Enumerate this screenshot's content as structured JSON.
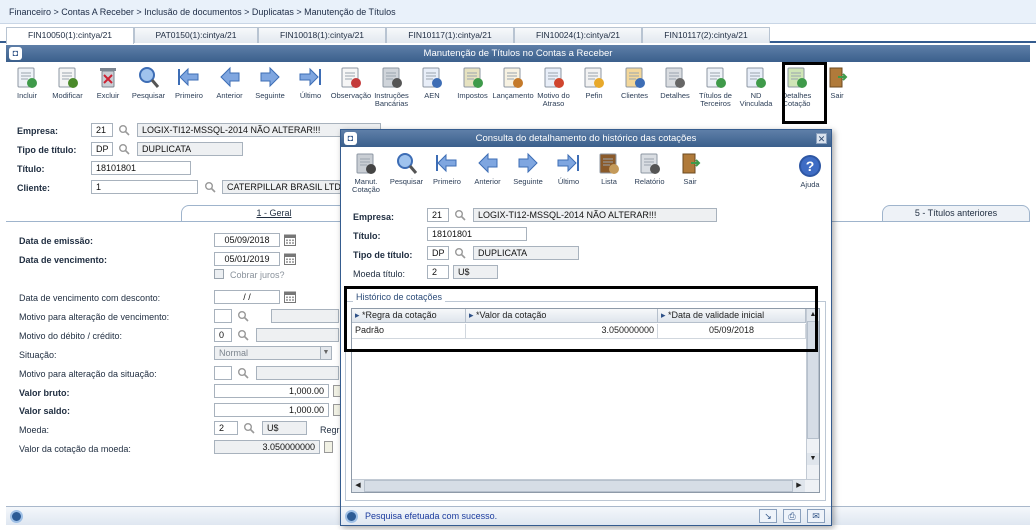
{
  "breadcrumb": "Financeiro > Contas A Receber > Inclusão de documentos > Duplicatas > Manutenção de Títulos",
  "tabs": [
    "FIN10050(1):cintya/21",
    "PAT0150(1):cintya/21",
    "FIN10018(1):cintya/21",
    "FIN10117(1):cintya/21",
    "FIN10024(1):cintya/21",
    "FIN10117(2):cintya/21"
  ],
  "main_window": {
    "title": "Manutenção de Títulos no Contas a Receber",
    "toolbar": [
      {
        "label": "Incluir",
        "icon": "add-document-icon"
      },
      {
        "label": "Modificar",
        "icon": "edit-check-icon"
      },
      {
        "label": "Excluir",
        "icon": "trash-icon"
      },
      {
        "label": "Pesquisar",
        "icon": "magnifier-icon"
      },
      {
        "label": "Primeiro",
        "icon": "first-arrow-icon"
      },
      {
        "label": "Anterior",
        "icon": "previous-arrow-icon"
      },
      {
        "label": "Seguinte",
        "icon": "next-arrow-icon"
      },
      {
        "label": "Último",
        "icon": "last-arrow-icon"
      },
      {
        "label": "Observação",
        "icon": "note-pen-icon"
      },
      {
        "label": "Instruções Bancárias",
        "icon": "bank-instructions-icon"
      },
      {
        "label": "AEN",
        "icon": "aen-form-icon"
      },
      {
        "label": "Impostos",
        "icon": "taxes-icon"
      },
      {
        "label": "Lançamento",
        "icon": "posting-icon"
      },
      {
        "label": "Motivo do Atraso",
        "icon": "delay-reason-icon"
      },
      {
        "label": "Pefin",
        "icon": "pefin-icon"
      },
      {
        "label": "Clientes",
        "icon": "clients-icon"
      },
      {
        "label": "Detalhes",
        "icon": "details-tools-icon"
      },
      {
        "label": "Títulos de Terceiros",
        "icon": "third-party-titles-icon"
      },
      {
        "label": "ND Vinculada",
        "icon": "nd-linked-icon"
      },
      {
        "label": "Detalhes Cotação",
        "icon": "quote-details-icon"
      },
      {
        "label": "Sair",
        "icon": "exit-door-icon"
      }
    ],
    "form": {
      "empresa_label": "Empresa:",
      "empresa_code": "21",
      "empresa_name": "LOGIX-TI12-MSSQL-2014 NÃO ALTERAR!!!",
      "tipo_label": "Tipo de título:",
      "tipo_code": "DP",
      "tipo_name": "DUPLICATA",
      "titulo_label": "Título:",
      "titulo_value": "18101801",
      "cliente_label": "Cliente:",
      "cliente_code": "1",
      "cliente_name": "CATERPILLAR BRASIL LTDA"
    },
    "folder_tabs": {
      "geral": "1 - Geral",
      "anteriores": "5 - Títulos anteriores"
    },
    "geral": {
      "emissao_label": "Data de emissão:",
      "emissao_value": "05/09/2018",
      "vencimento_label": "Data de vencimento:",
      "vencimento_value": "05/01/2019",
      "cobrar_juros": "Cobrar juros?",
      "venc_desconto_label": "Data de vencimento com desconto:",
      "venc_desconto_value": "/ /",
      "motivo_alt_label": "Motivo para alteração de vencimento:",
      "motivo_debito_label": "Motivo do débito / crédito:",
      "motivo_debito_value": "0",
      "situacao_label": "Situação:",
      "situacao_value": "Normal",
      "motivo_sit_label": "Motivo para alteração da situação:",
      "valor_bruto_label": "Valor bruto:",
      "valor_bruto_value": "1,000.00",
      "valor_saldo_label": "Valor saldo:",
      "valor_saldo_value": "1,000.00",
      "moeda_label": "Moeda:",
      "moeda_code": "2",
      "moeda_symbol": "U$",
      "regra_label": "Regr",
      "cotacao_label": "Valor da cotação da moeda:",
      "cotacao_value": "3.050000000"
    }
  },
  "modal": {
    "title": "Consulta do detalhamento do histórico das cotações",
    "toolbar": [
      {
        "label": "Manut. Cotação",
        "icon": "quote-maintenance-icon"
      },
      {
        "label": "Pesquisar",
        "icon": "magnifier-icon"
      },
      {
        "label": "Primeiro",
        "icon": "first-arrow-icon"
      },
      {
        "label": "Anterior",
        "icon": "previous-arrow-icon"
      },
      {
        "label": "Seguinte",
        "icon": "next-arrow-icon"
      },
      {
        "label": "Último",
        "icon": "last-arrow-icon"
      },
      {
        "label": "Lista",
        "icon": "book-list-icon"
      },
      {
        "label": "Relatório",
        "icon": "printer-icon"
      },
      {
        "label": "Sair",
        "icon": "exit-door-icon"
      }
    ],
    "help_label": "Ajuda",
    "form": {
      "empresa_label": "Empresa:",
      "empresa_code": "21",
      "empresa_name": "LOGIX-TI12-MSSQL-2014 NÃO ALTERAR!!!",
      "titulo_label": "Título:",
      "titulo_value": "18101801",
      "tipo_label": "Tipo de título:",
      "tipo_code": "DP",
      "tipo_name": "DUPLICATA",
      "moeda_label": "Moeda título:",
      "moeda_code": "2",
      "moeda_symbol": "U$"
    },
    "group_title": "Histórico de cotações",
    "grid": {
      "columns": [
        "*Regra da cotação",
        "*Valor da cotação",
        "*Data de validade inicial"
      ],
      "rows": [
        [
          "Padrão",
          "3.050000000",
          "05/09/2018"
        ]
      ]
    },
    "status": "Pesquisa efetuada com sucesso."
  },
  "colors": {
    "title_bar": "#3b5f8c",
    "highlight": "#000000"
  }
}
